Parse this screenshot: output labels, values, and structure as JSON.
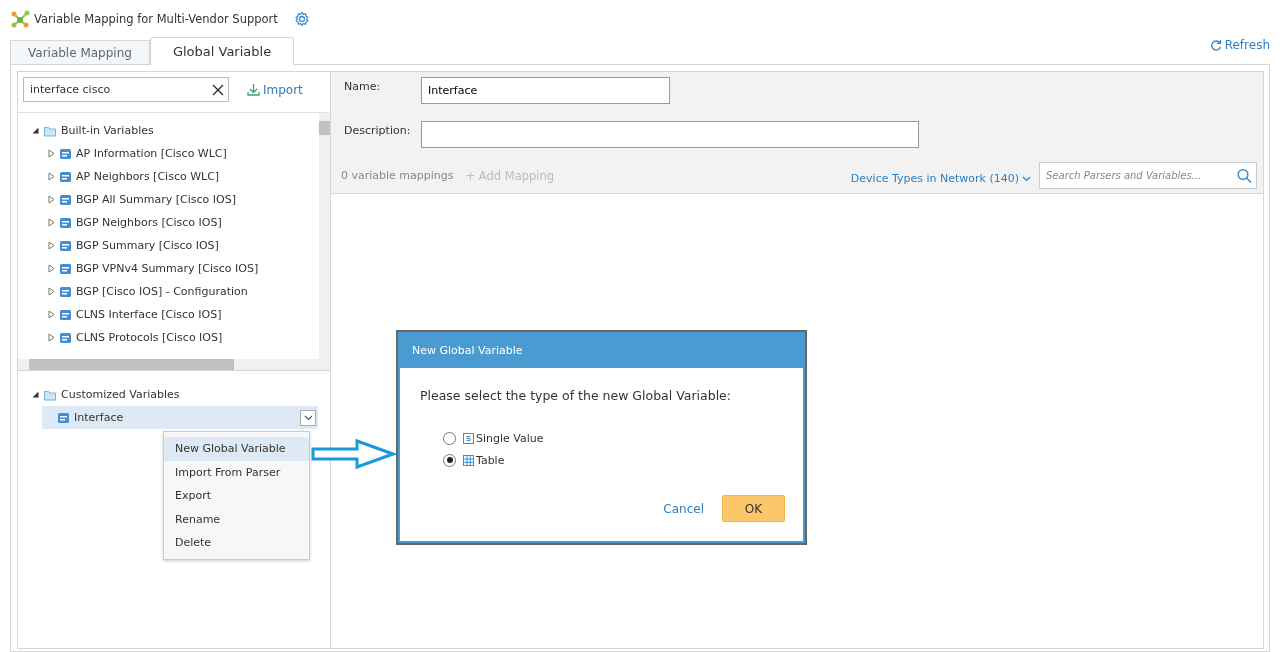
{
  "app": {
    "title": "Variable Mapping for Multi-Vendor Support"
  },
  "tabs": [
    {
      "label": "Variable Mapping",
      "selected": false
    },
    {
      "label": "Global Variable",
      "selected": true
    }
  ],
  "refresh": "Refresh",
  "search": {
    "value": "interface cisco"
  },
  "import": "Import",
  "builtin_tree": {
    "label": "Built-in Variables",
    "expanded": true,
    "children": [
      {
        "label": "AP Information [Cisco WLC]",
        "expanded": false
      },
      {
        "label": "AP Neighbors [Cisco WLC]",
        "expanded": false
      },
      {
        "label": "BGP All Summary [Cisco IOS]",
        "expanded": false
      },
      {
        "label": "BGP Neighbors [Cisco IOS]",
        "expanded": false
      },
      {
        "label": "BGP Summary [Cisco IOS]",
        "expanded": false
      },
      {
        "label": "BGP VPNv4 Summary [Cisco IOS]",
        "expanded": false
      },
      {
        "label": "BGP [Cisco IOS] - Configuration",
        "expanded": false
      },
      {
        "label": "CLNS Interface [Cisco IOS]",
        "expanded": false
      },
      {
        "label": "CLNS Protocols [Cisco IOS]",
        "expanded": false
      }
    ]
  },
  "customized_tree": {
    "label": "Customized Variables",
    "expanded": true,
    "children": [
      {
        "label": "Interface",
        "selected": true
      }
    ]
  },
  "form": {
    "name_label": "Name:",
    "name_value": "Interface",
    "description_label": "Description:"
  },
  "mappings_count": "0 variable mappings",
  "add_mapping": {
    "label": "+ Add Mapping",
    "disabled": true
  },
  "device_types": "Device Types in Network (140)",
  "parser_search": {
    "placeholder": "Search Parsers and Variables..."
  },
  "context_menu": [
    {
      "label": "New Global Variable",
      "selected": true
    },
    {
      "label": "Import From Parser",
      "selected": false
    },
    {
      "label": "Export",
      "selected": false
    },
    {
      "label": "Rename",
      "selected": false
    },
    {
      "label": "Delete",
      "selected": false
    }
  ],
  "dialog": {
    "title": "New Global Variable",
    "prompt": "Please select the type of the new Global Variable:",
    "options": [
      {
        "label": "Single Value",
        "kind": "single",
        "selected": false
      },
      {
        "label": "Table",
        "kind": "table",
        "selected": true
      }
    ],
    "cancel": "Cancel",
    "ok": "OK"
  }
}
